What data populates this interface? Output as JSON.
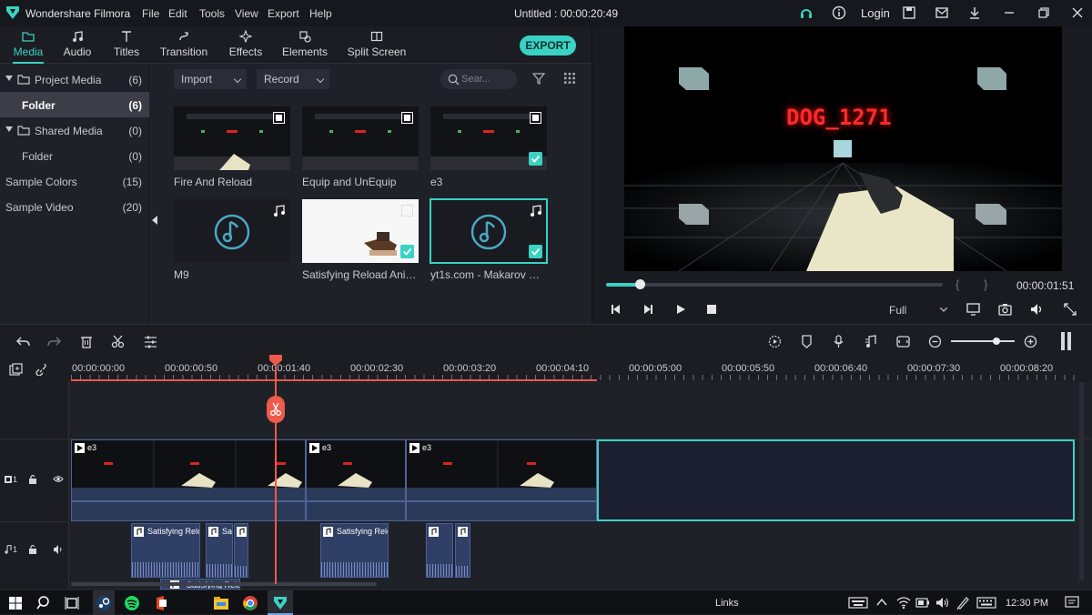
{
  "app": {
    "name": "Wondershare Filmora",
    "menu": [
      "File",
      "Edit",
      "Tools",
      "View",
      "Export",
      "Help"
    ],
    "document_title": "Untitled : 00:00:20:49",
    "login": "Login"
  },
  "tabs": [
    "Media",
    "Audio",
    "Titles",
    "Transition",
    "Effects",
    "Elements",
    "Split Screen"
  ],
  "export_label": "EXPORT",
  "sidebar": {
    "items": [
      {
        "label": "Project Media",
        "count": "(6)"
      },
      {
        "label": "Folder",
        "count": "(6)"
      },
      {
        "label": "Shared Media",
        "count": "(0)"
      },
      {
        "label": "Folder",
        "count": "(0)"
      },
      {
        "label": "Sample Colors",
        "count": "(15)"
      },
      {
        "label": "Sample Video",
        "count": "(20)"
      }
    ]
  },
  "media_toolbar": {
    "import_label": "Import",
    "record_label": "Record",
    "search_placeholder": "Sear..."
  },
  "media_items": [
    {
      "name": "Fire And Reload",
      "kind": "video",
      "checked": false
    },
    {
      "name": "Equip and UnEquip",
      "kind": "video",
      "checked": false
    },
    {
      "name": "e3",
      "kind": "video",
      "checked": true
    },
    {
      "name": "M9",
      "kind": "audio",
      "checked": false
    },
    {
      "name": "Satisfying Reload Animat...",
      "kind": "image",
      "checked": true
    },
    {
      "name": "yt1s.com - Makarov PM ...",
      "kind": "audio",
      "checked": true
    }
  ],
  "preview": {
    "overlay_text": "DOG_1271",
    "timecode": "00:00:01:51",
    "quality": "Full",
    "progress": 0.1
  },
  "ruler_labels": [
    "00:00:00:00",
    "00:00:00:50",
    "00:00:01:40",
    "00:00:02:30",
    "00:00:03:20",
    "00:00:04:10",
    "00:00:05:00",
    "00:00:05:50",
    "00:00:06:40",
    "00:00:07:30",
    "00:00:08:20"
  ],
  "video_clips": [
    "e3",
    "e3",
    "e3"
  ],
  "audio_clips": [
    "Satisfying Relo",
    "Sa",
    "",
    "Satisfying Relo",
    "",
    "",
    "Satisfying Relo"
  ],
  "track_labels": {
    "video": "1",
    "audio": "1"
  },
  "taskbar": {
    "links": "Links",
    "clock": "12:30 PM"
  },
  "colors": {
    "accent": "#3ad2c3",
    "playhead": "#ef5a4a",
    "clip_blue": "#2c3a5a"
  }
}
